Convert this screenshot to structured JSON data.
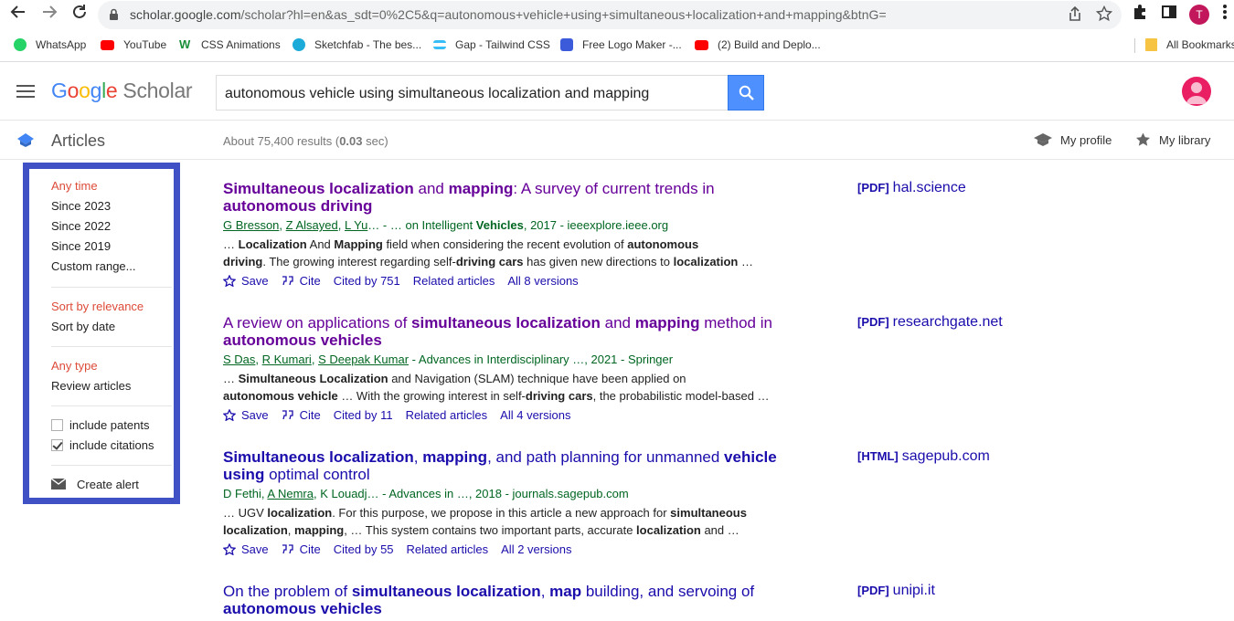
{
  "browser": {
    "url_domain": "scholar.google.com",
    "url_rest": "/scholar?hl=en&as_sdt=0%2C5&q=autonomous+vehicle+using+simultaneous+localization+and+mapping&btnG=",
    "profile_initial": "T",
    "bookmarks": [
      {
        "label": "WhatsApp",
        "icon": "whatsapp-icon",
        "color": "#25d366"
      },
      {
        "label": "YouTube",
        "icon": "youtube-icon",
        "color": "#ff0000"
      },
      {
        "label": "CSS Animations",
        "icon": "w-logo-icon",
        "color": "#1a8f3a"
      },
      {
        "label": "Sketchfab - The bes...",
        "icon": "sketchfab-icon",
        "color": "#1caad9"
      },
      {
        "label": "Gap - Tailwind CSS",
        "icon": "tailwind-icon",
        "color": "#38bdf8"
      },
      {
        "label": "Free Logo Maker -...",
        "icon": "logo-maker-icon",
        "color": "#3b5bdb"
      },
      {
        "label": "(2) Build and Deplo...",
        "icon": "youtube-icon",
        "color": "#ff0000"
      }
    ],
    "all_bookmarks": "All Bookmarks"
  },
  "header": {
    "logo_google": "Google",
    "logo_scholar": "Scholar",
    "query": "autonomous vehicle using simultaneous localization and mapping"
  },
  "subheader": {
    "section": "Articles",
    "results_prefix": "About 75,400 results (",
    "results_time": "0.03",
    "results_suffix": " sec)",
    "my_profile": "My profile",
    "my_library": "My library"
  },
  "sidebar": {
    "time": [
      "Any time",
      "Since 2023",
      "Since 2022",
      "Since 2019",
      "Custom range..."
    ],
    "sort": [
      "Sort by relevance",
      "Sort by date"
    ],
    "type": [
      "Any type",
      "Review articles"
    ],
    "include_patents": "include patents",
    "include_citations": "include citations",
    "create_alert": "Create alert"
  },
  "results": [
    {
      "side_format": "[PDF]",
      "side_source": "hal.science",
      "save": "Save",
      "cite": "Cite",
      "cited_by": "Cited by 751",
      "related": "Related articles",
      "versions": "All 8 versions"
    },
    {
      "side_format": "[PDF]",
      "side_source": "researchgate.net",
      "save": "Save",
      "cite": "Cite",
      "cited_by": "Cited by 11",
      "related": "Related articles",
      "versions": "All 4 versions"
    },
    {
      "side_format": "[HTML]",
      "side_source": "sagepub.com",
      "save": "Save",
      "cite": "Cite",
      "cited_by": "Cited by 55",
      "related": "Related articles",
      "versions": "All 2 versions"
    },
    {
      "side_format": "[PDF]",
      "side_source": "unipi.it"
    }
  ],
  "colors": {
    "accent": "#4d90fe",
    "link": "#1a0dab",
    "visited": "#660099",
    "author_green": "#006621",
    "active_red": "#dd4b39",
    "sidebar_border": "#3f51c5"
  }
}
